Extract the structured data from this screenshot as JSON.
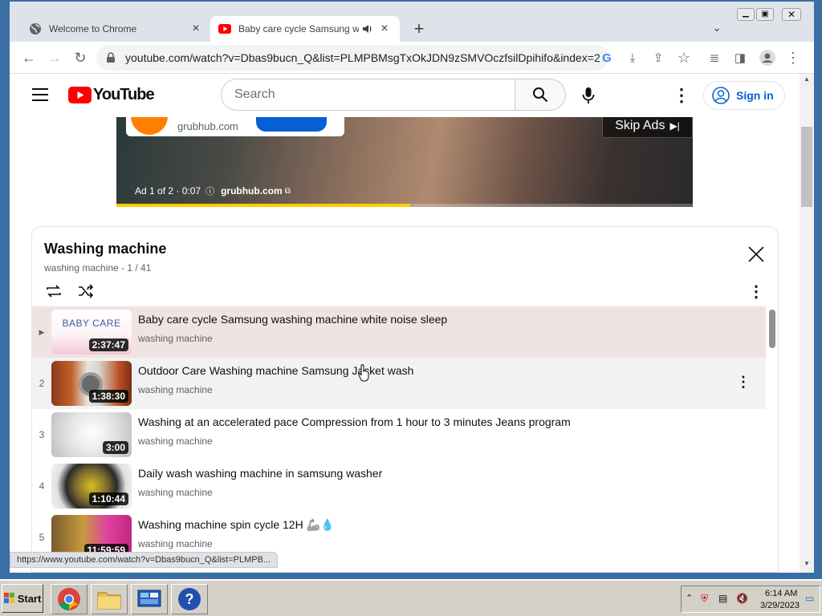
{
  "browser": {
    "tabs": [
      {
        "title": "Welcome to Chrome"
      },
      {
        "title": "Baby care cycle Samsung washing machine white noise sleep - YouTube"
      }
    ],
    "url": "youtube.com/watch?v=Dbas9bucn_Q&list=PLMPBMsgTxOkJDN9zSMVOczfsilDpihifo&index=2",
    "status_url": "https://www.youtube.com/watch?v=Dbas9bucn_Q&list=PLMPB..."
  },
  "youtube": {
    "logo_text": "YouTube",
    "search_placeholder": "Search",
    "sign_in": "Sign in"
  },
  "ad": {
    "domain": "grubhub.com",
    "skip_label": "Skip Ads",
    "info": "Ad 1 of 2 · 0:07",
    "link": "grubhub.com",
    "progress": 0.51
  },
  "playlist": {
    "title": "Washing machine",
    "subtitle": "washing machine - 1 / 41",
    "items": [
      {
        "index": "▶",
        "title": "Baby care cycle Samsung washing machine white noise sleep",
        "channel": "washing machine",
        "duration": "2:37:47",
        "thumb_text": "BABY CARE"
      },
      {
        "index": "2",
        "title": "Outdoor Care Washing machine Samsung Jacket wash",
        "channel": "washing machine",
        "duration": "1:38:30"
      },
      {
        "index": "3",
        "title": "Washing at an accelerated pace Compression from 1 hour to 3 minutes Jeans program",
        "channel": "washing machine",
        "duration": "3:00"
      },
      {
        "index": "4",
        "title": "Daily wash washing machine in samsung washer",
        "channel": "washing machine",
        "duration": "1:10:44"
      },
      {
        "index": "5",
        "title": "Washing machine spin cycle 12H 🦾💧",
        "channel": "washing machine",
        "duration": "11:59:59"
      }
    ]
  },
  "taskbar": {
    "start": "Start",
    "time": "6:14 AM",
    "date": "3/29/2023"
  },
  "colors": {
    "yt_red": "#ff0000",
    "link_blue": "#065fd4",
    "ad_progress": "#ffcc00",
    "active_row": "#f0e4e2"
  }
}
